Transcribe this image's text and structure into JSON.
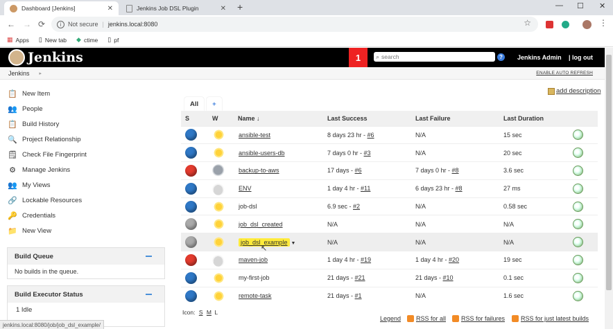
{
  "browser": {
    "tabs": [
      {
        "title": "Dashboard [Jenkins]",
        "active": true
      },
      {
        "title": "Jenkins Job DSL Plugin",
        "active": false
      }
    ],
    "url_security": "Not secure",
    "url": "jenkins.local:8080",
    "bookmarks": [
      "Apps",
      "New tab",
      "ctime",
      "pf"
    ],
    "window_controls": {
      "minimize": "—",
      "maximize": "☐",
      "close": "✕"
    }
  },
  "header": {
    "brand": "Jenkins",
    "notification_count": "1",
    "search_placeholder": "search",
    "user": "Jenkins Admin",
    "logout": "| log out"
  },
  "breadcrumb": {
    "root": "Jenkins",
    "auto_refresh": "ENABLE AUTO REFRESH"
  },
  "side_tasks": [
    {
      "label": "New Item",
      "icon": "notepad-icon"
    },
    {
      "label": "People",
      "icon": "people-icon"
    },
    {
      "label": "Build History",
      "icon": "notepad-icon"
    },
    {
      "label": "Project Relationship",
      "icon": "search-icon"
    },
    {
      "label": "Check File Fingerprint",
      "icon": "fingerprint-icon"
    },
    {
      "label": "Manage Jenkins",
      "icon": "gear-icon"
    },
    {
      "label": "My Views",
      "icon": "people-icon"
    },
    {
      "label": "Lockable Resources",
      "icon": "lock-icon"
    },
    {
      "label": "Credentials",
      "icon": "key-icon"
    },
    {
      "label": "New View",
      "icon": "folder-icon"
    }
  ],
  "build_queue": {
    "title": "Build Queue",
    "empty": "No builds in the queue."
  },
  "executor_status": {
    "title": "Build Executor Status",
    "first": "1  Idle"
  },
  "main": {
    "add_description": "add description",
    "views": [
      "All",
      "+"
    ],
    "columns": {
      "s": "S",
      "w": "W",
      "name": "Name  ↓",
      "last_success": "Last Success",
      "last_failure": "Last Failure",
      "last_duration": "Last Duration"
    },
    "jobs": [
      {
        "status": "blue",
        "weather": "sun",
        "name": "ansible-test",
        "success": "8 days 23 hr - ",
        "success_build": "#6",
        "failure": "N/A",
        "failure_build": "",
        "duration": "15 sec",
        "linked": true
      },
      {
        "status": "blue",
        "weather": "sun",
        "name": "ansible-users-db",
        "success": "7 days 0 hr - ",
        "success_build": "#3",
        "failure": "N/A",
        "failure_build": "",
        "duration": "20 sec",
        "linked": true
      },
      {
        "status": "red",
        "weather": "rain",
        "name": "backup-to-aws",
        "success": "17 days - ",
        "success_build": "#6",
        "failure": "7 days 0 hr - ",
        "failure_build": "#8",
        "duration": "3.6 sec",
        "linked": true
      },
      {
        "status": "blue",
        "weather": "cloud",
        "name": "ENV",
        "success": "1 day 4 hr - ",
        "success_build": "#11",
        "failure": "6 days 23 hr - ",
        "failure_build": "#8",
        "duration": "27 ms",
        "linked": true
      },
      {
        "status": "blue",
        "weather": "sun",
        "name": "job-dsl",
        "success": "6.9 sec - ",
        "success_build": "#2",
        "failure": "N/A",
        "failure_build": "",
        "duration": "0.58 sec",
        "linked": false
      },
      {
        "status": "grey",
        "weather": "sun",
        "name": "job_dsl_created",
        "success": "N/A",
        "success_build": "",
        "failure": "N/A",
        "failure_build": "",
        "duration": "N/A",
        "linked": true
      },
      {
        "status": "grey",
        "weather": "sun",
        "name": "job_dsl_example",
        "success": "N/A",
        "success_build": "",
        "failure": "N/A",
        "failure_build": "",
        "duration": "N/A",
        "linked": true,
        "selected": true
      },
      {
        "status": "red",
        "weather": "cloud",
        "name": "maven-job",
        "success": "1 day 4 hr - ",
        "success_build": "#19",
        "failure": "1 day 4 hr - ",
        "failure_build": "#20",
        "duration": "19 sec",
        "linked": true
      },
      {
        "status": "blue",
        "weather": "sun",
        "name": "my-first-job",
        "success": "21 days - ",
        "success_build": "#21",
        "failure": "21 days - ",
        "failure_build": "#10",
        "duration": "0.1 sec",
        "linked": false
      },
      {
        "status": "blue",
        "weather": "sun",
        "name": "remote-task",
        "success": "21 days - ",
        "success_build": "#1",
        "failure": "N/A",
        "failure_build": "",
        "duration": "1.6 sec",
        "linked": true
      }
    ],
    "icon_label": "Icon:",
    "icon_sizes": [
      "S",
      "M",
      "L"
    ],
    "legend": "Legend",
    "rss_all": "RSS for all",
    "rss_failures": "RSS for failures",
    "rss_latest": "RSS for just latest builds"
  },
  "status_bar": "jenkins.local:8080/job/job_dsl_example/",
  "colors": {
    "blue": "#2f78c6",
    "red": "#e33b2e",
    "grey": "#aaaaaa",
    "accent": "#3b7ddd",
    "badge": "#ee2222"
  }
}
